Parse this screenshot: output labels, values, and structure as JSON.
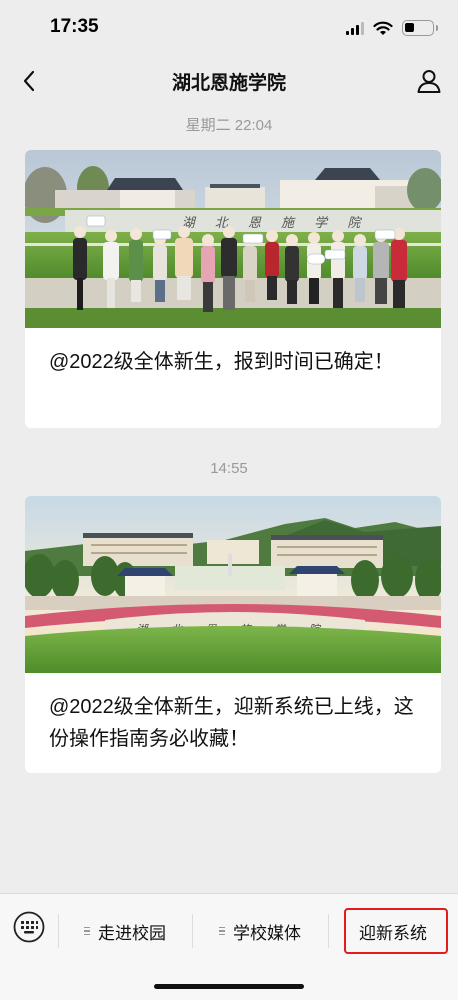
{
  "status_bar": {
    "time": "17:35"
  },
  "nav": {
    "title": "湖北恩施学院"
  },
  "messages": [
    {
      "timestamp": "星期二 22:04",
      "text": "@2022级全体新生，报到时间已确定！",
      "image_text": "湖 北 恩 施 学 院"
    },
    {
      "timestamp": "14:55",
      "text": "@2022级全体新生，迎新系统已上线，这份操作指南务必收藏！",
      "image_text": "湖 北 恩 施 学 院"
    }
  ],
  "menu": {
    "items": [
      {
        "label": "走进校园",
        "has_submenu": true
      },
      {
        "label": "学校媒体",
        "has_submenu": true
      },
      {
        "label": "迎新系统",
        "has_submenu": false
      }
    ]
  },
  "colors": {
    "background": "#ededed",
    "highlight": "#e01c1c"
  },
  "icons": {
    "back": "chevron-left-icon",
    "profile": "person-icon",
    "keyboard": "keyboard-icon"
  }
}
